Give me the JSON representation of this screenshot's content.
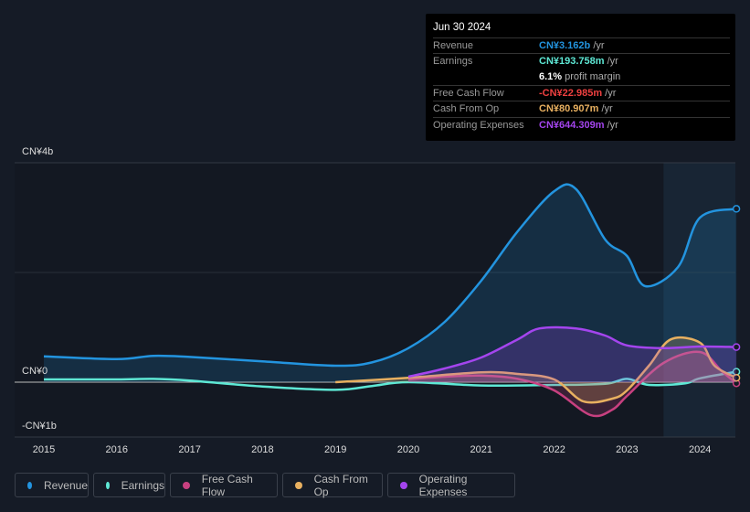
{
  "tooltip": {
    "date": "Jun 30 2024",
    "rows": [
      {
        "label": "Revenue",
        "value": "CN¥3.162b",
        "unit": " /yr",
        "color": "#2394df"
      },
      {
        "label": "Earnings",
        "value": "CN¥193.758m",
        "unit": " /yr",
        "color": "#5ee8d5"
      },
      {
        "label": "",
        "value": "6.1%",
        "unit": " profit margin",
        "color": "#ffffff"
      },
      {
        "label": "Free Cash Flow",
        "value": "-CN¥22.985m",
        "unit": " /yr",
        "color": "#ee4040"
      },
      {
        "label": "Cash From Op",
        "value": "CN¥80.907m",
        "unit": " /yr",
        "color": "#e8b060"
      },
      {
        "label": "Operating Expenses",
        "value": "CN¥644.309m",
        "unit": " /yr",
        "color": "#a445ee"
      }
    ]
  },
  "chart_data": {
    "type": "line",
    "y_unit": "CN¥ b",
    "ylim": [
      -1,
      4
    ],
    "xlim": [
      2014.6,
      2024.5
    ],
    "y_tick_labels": [
      "CN¥4b",
      "CN¥0",
      "-CN¥1b"
    ],
    "y_ticks": [
      4,
      0,
      -1
    ],
    "x_ticks": [
      "2015",
      "2016",
      "2017",
      "2018",
      "2019",
      "2020",
      "2021",
      "2022",
      "2023",
      "2024"
    ],
    "highlight_from": 2023.5,
    "series": [
      {
        "name": "Revenue",
        "color": "#2394df",
        "fill": true,
        "points": [
          [
            2015,
            0.47
          ],
          [
            2016,
            0.42
          ],
          [
            2016.5,
            0.48
          ],
          [
            2017,
            0.46
          ],
          [
            2018,
            0.38
          ],
          [
            2019,
            0.3
          ],
          [
            2019.5,
            0.36
          ],
          [
            2020,
            0.62
          ],
          [
            2020.5,
            1.1
          ],
          [
            2021,
            1.85
          ],
          [
            2021.5,
            2.75
          ],
          [
            2022,
            3.48
          ],
          [
            2022.3,
            3.52
          ],
          [
            2022.7,
            2.6
          ],
          [
            2023,
            2.3
          ],
          [
            2023.25,
            1.75
          ],
          [
            2023.7,
            2.1
          ],
          [
            2024,
            3.0
          ],
          [
            2024.5,
            3.16
          ]
        ]
      },
      {
        "name": "Earnings",
        "color": "#5ee8d5",
        "fill": false,
        "points": [
          [
            2015,
            0.05
          ],
          [
            2016,
            0.05
          ],
          [
            2016.5,
            0.06
          ],
          [
            2017,
            0.03
          ],
          [
            2018,
            -0.08
          ],
          [
            2019,
            -0.14
          ],
          [
            2019.5,
            -0.07
          ],
          [
            2020,
            0.0
          ],
          [
            2021,
            -0.06
          ],
          [
            2022,
            -0.05
          ],
          [
            2022.7,
            -0.03
          ],
          [
            2023,
            0.06
          ],
          [
            2023.3,
            -0.05
          ],
          [
            2023.8,
            -0.02
          ],
          [
            2024,
            0.07
          ],
          [
            2024.5,
            0.19
          ]
        ]
      },
      {
        "name": "Free Cash Flow",
        "color": "#c84080",
        "fill": true,
        "points": [
          [
            2020,
            0.05
          ],
          [
            2020.5,
            0.1
          ],
          [
            2021,
            0.12
          ],
          [
            2021.5,
            0.06
          ],
          [
            2022,
            -0.15
          ],
          [
            2022.5,
            -0.6
          ],
          [
            2022.8,
            -0.5
          ],
          [
            2023,
            -0.25
          ],
          [
            2023.5,
            0.35
          ],
          [
            2024,
            0.55
          ],
          [
            2024.3,
            0.2
          ],
          [
            2024.5,
            -0.02
          ]
        ]
      },
      {
        "name": "Cash From Op",
        "color": "#e8b060",
        "fill": true,
        "points": [
          [
            2019,
            0.0
          ],
          [
            2020,
            0.08
          ],
          [
            2021,
            0.18
          ],
          [
            2021.5,
            0.15
          ],
          [
            2022,
            0.05
          ],
          [
            2022.4,
            -0.35
          ],
          [
            2022.8,
            -0.3
          ],
          [
            2023,
            -0.15
          ],
          [
            2023.3,
            0.3
          ],
          [
            2023.6,
            0.78
          ],
          [
            2024,
            0.72
          ],
          [
            2024.2,
            0.3
          ],
          [
            2024.5,
            0.08
          ]
        ]
      },
      {
        "name": "Operating Expenses",
        "color": "#a445ee",
        "fill": true,
        "points": [
          [
            2020,
            0.1
          ],
          [
            2020.5,
            0.25
          ],
          [
            2021,
            0.45
          ],
          [
            2021.5,
            0.78
          ],
          [
            2021.8,
            0.98
          ],
          [
            2022.3,
            0.98
          ],
          [
            2022.7,
            0.85
          ],
          [
            2023,
            0.67
          ],
          [
            2023.5,
            0.62
          ],
          [
            2024,
            0.65
          ],
          [
            2024.5,
            0.64
          ]
        ]
      }
    ]
  },
  "legend": [
    "Revenue",
    "Earnings",
    "Free Cash Flow",
    "Cash From Op",
    "Operating Expenses"
  ]
}
